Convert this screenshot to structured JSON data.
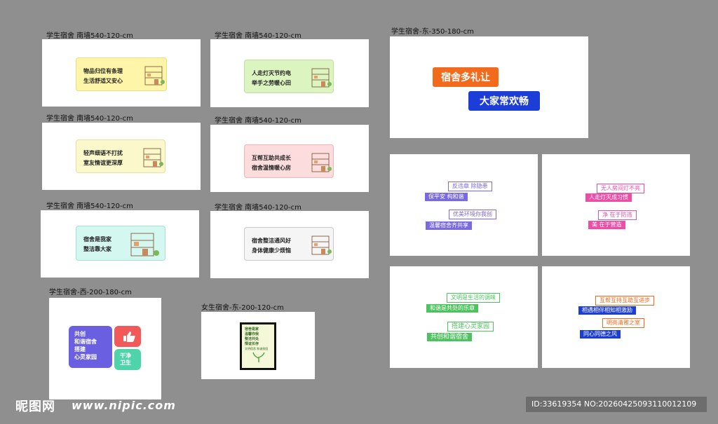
{
  "captions": {
    "c1": "学生宿舍 南墙540-120-cm",
    "c2": "学生宿舍 南墙540-120-cm",
    "c3": "学生宿舍 南墙540-120-cm",
    "c4": "学生宿舍 南墙540-120-cm",
    "c5": "学生宿舍 南墙540-120-cm",
    "c6": "学生宿舍 南墙540-120-cm",
    "c7": "学生宿舍-东-350-180-cm",
    "c8": "学生宿舍-西-200-180-cm",
    "c9": "女生宿舍-东-200-120-cm"
  },
  "signs": {
    "s1": {
      "l1": "物品归位有条理",
      "l2": "生活舒适又安心",
      "color": "#fff5a8"
    },
    "s2": {
      "l1": "人走灯灭节约电",
      "l2": "举手之劳暖心田",
      "color": "#dcf5c0"
    },
    "s3": {
      "l1": "轻声细语不打扰",
      "l2": "室友情谊更深厚",
      "color": "#fbf8cc"
    },
    "s4": {
      "l1": "互帮互助共成长",
      "l2": "宿舍温情暖心房",
      "color": "#fcdcdc"
    },
    "s5": {
      "l1": "宿舍是我家",
      "l2": "整洁靠大家",
      "color": "#d4f7f0"
    },
    "s6": {
      "l1": "宿舍整洁通风好",
      "l2": "身体健康少烦恼",
      "color": "#f5f5f5"
    }
  },
  "east": {
    "line1": "宿舍多礼让",
    "line2": "大家常欢畅",
    "color1": "#f26a1b",
    "color2": "#1d3ed6"
  },
  "west": {
    "big": "共创\n和谐宿舍\n搭建\n心灵家园",
    "small": "干净\n卫生",
    "color1": "#6a5fe0",
    "color2": "#f25a5a",
    "color3": "#4fd3a8"
  },
  "girls": {
    "lines": [
      "宿舍是家",
      "温馨你我",
      "整洁共处",
      "情谊长存",
      "文明宿舍 和谐校园"
    ]
  },
  "slogan_sets": {
    "p1": [
      "反违章 除隐患",
      "保平安 构和谐",
      "优美环境你我创",
      "温馨宿舍齐共享"
    ],
    "p2": [
      "无人房间灯不亮",
      "人走灯灭成习惯",
      "净 在于防违",
      "美 在于营造"
    ],
    "p3": [
      "文明是生活的调味",
      "和谐是共处的乐章",
      "搭建心灵家园",
      "共创和谐宿舍"
    ],
    "p4": [
      "互帮互持互助互进步",
      "相遇相伴相知相激励",
      "明亮清雅之室",
      "同心同德之风"
    ]
  },
  "footer": {
    "logo": "昵图网",
    "url": "www.nipic.com",
    "id": "ID:33619354 NO:20260425093110012109"
  }
}
